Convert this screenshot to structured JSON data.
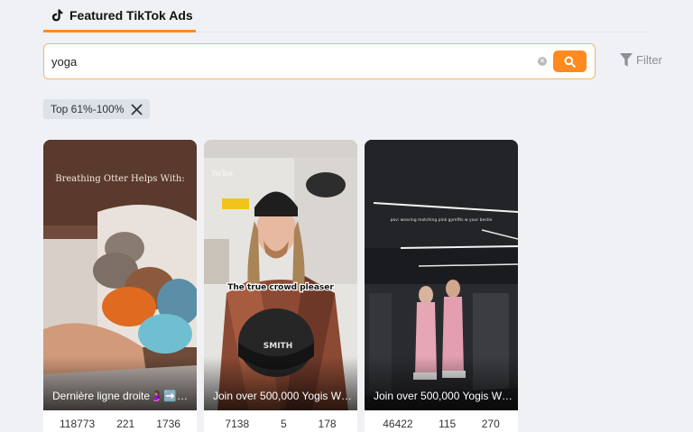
{
  "tab": {
    "label": "Featured TikTok Ads"
  },
  "search": {
    "value": "yoga",
    "placeholder": ""
  },
  "filter": {
    "label": "Filter"
  },
  "chip": {
    "label": "Top 61%-100%"
  },
  "cards": [
    {
      "title": "Dernière ligne droite🤰🏽➡️…",
      "overlay": "Breathing Otter Helps With:",
      "stats": [
        "118773",
        "221",
        "1736"
      ]
    },
    {
      "title": "Join over 500,000 Yogis Wo…",
      "overlay": "The true crowd pleaser",
      "watermark": "TikTok",
      "helmet_brand": "SMITH",
      "stats": [
        "7138",
        "5",
        "178"
      ]
    },
    {
      "title": "Join over 500,000 Yogis Wo…",
      "overlay": "pov: wearing matching pink gymfits w your bestie",
      "stats": [
        "46422",
        "115",
        "270"
      ]
    }
  ],
  "colors": {
    "accent": "#ff8a1f",
    "background": "#f0f1f4",
    "chip_bg": "#dde2e8"
  }
}
